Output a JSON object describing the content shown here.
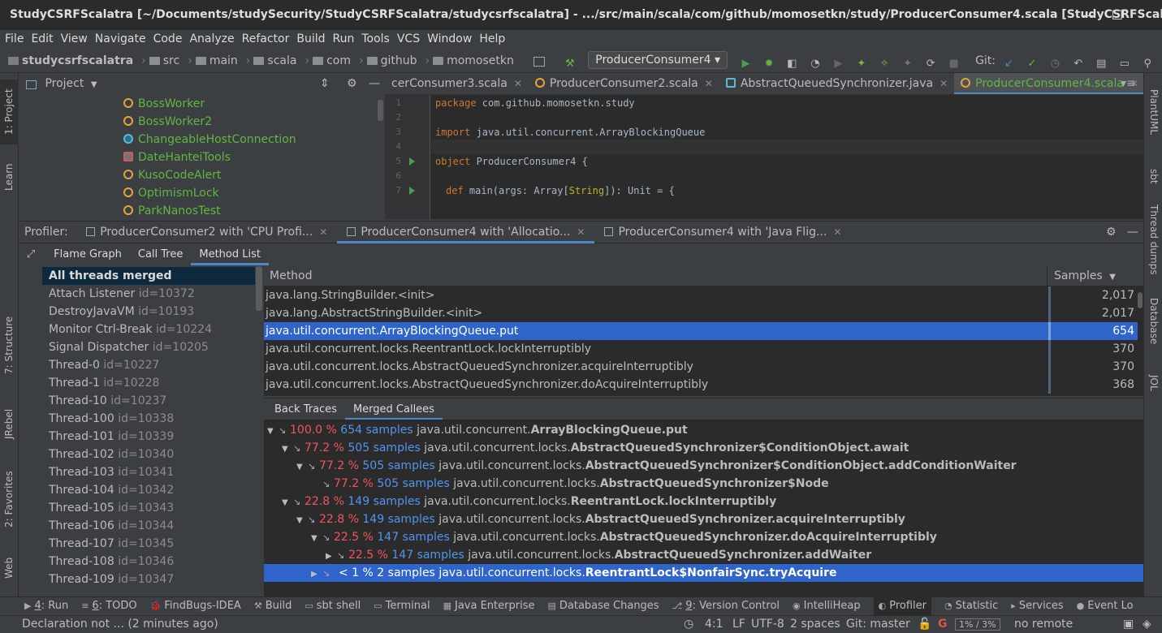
{
  "title_bar": {
    "title": "StudyCSRFScalatra [~/Documents/studySecurity/StudyCSRFScalatra/studycsrfscalatra] - .../src/main/scala/com/github/momosetkn/study/ProducerConsumer4.scala [StudyCSRFScalatra]"
  },
  "menu": [
    "File",
    "Edit",
    "View",
    "Navigate",
    "Code",
    "Analyze",
    "Refactor",
    "Build",
    "Run",
    "Tools",
    "VCS",
    "Window",
    "Help"
  ],
  "breadcrumbs": [
    "studycsrfscalatra",
    "src",
    "main",
    "scala",
    "com",
    "github",
    "momosetkn"
  ],
  "run_config": "ProducerConsumer4",
  "git_label": "Git:",
  "left_strip": [
    "1: Project",
    "Learn",
    "7: Structure",
    "JRebel",
    "2: Favorites",
    "Web"
  ],
  "right_strip": [
    "PlantUML",
    "sbt",
    "Thread dumps",
    "Database",
    "JOL"
  ],
  "project_panel": {
    "title": "Project",
    "items": [
      "BossWorker",
      "BossWorker2",
      "ChangeableHostConnection",
      "DateHanteiTools",
      "KusoCodeAlert",
      "OptimismLock",
      "ParkNanosTest"
    ]
  },
  "editor_tabs": [
    {
      "label": "cerConsumer3.scala",
      "active": false
    },
    {
      "label": "ProducerConsumer2.scala",
      "active": false
    },
    {
      "label": "AbstractQueuedSynchronizer.java",
      "active": false
    },
    {
      "label": "ProducerConsumer4.scala",
      "active": true
    }
  ],
  "editor": {
    "lines": [
      "1",
      "2",
      "3",
      "4",
      "5",
      "6",
      "7"
    ],
    "line1": {
      "kw": "package",
      "rest": " com.github.momosetkn.study"
    },
    "line3": {
      "kw": "import",
      "rest": " java.util.concurrent.ArrayBlockingQueue"
    },
    "line5": {
      "kw": "object",
      "rest": " ProducerConsumer4 {"
    },
    "line7": {
      "kw": "def",
      "name": " main(args: Array[",
      "type": "String",
      "rest": "]): Unit = {"
    }
  },
  "profiler": {
    "label": "Profiler:",
    "tabs": [
      {
        "label": "ProducerConsumer2 with 'CPU Profi...",
        "active": false
      },
      {
        "label": "ProducerConsumer4 with 'Allocatio...",
        "active": true
      },
      {
        "label": "ProducerConsumer4 with 'Java Flig...",
        "active": false
      }
    ],
    "subtabs": [
      "Flame Graph",
      "Call Tree",
      "Method List"
    ],
    "active_subtab": "Method List"
  },
  "threads": [
    {
      "name": "All threads merged",
      "id": ""
    },
    {
      "name": "Attach Listener",
      "id": "id=10372"
    },
    {
      "name": "DestroyJavaVM",
      "id": "id=10193"
    },
    {
      "name": "Monitor Ctrl-Break",
      "id": "id=10224"
    },
    {
      "name": "Signal Dispatcher",
      "id": "id=10205"
    },
    {
      "name": "Thread-0",
      "id": "id=10227"
    },
    {
      "name": "Thread-1",
      "id": "id=10228"
    },
    {
      "name": "Thread-10",
      "id": "id=10237"
    },
    {
      "name": "Thread-100",
      "id": "id=10338"
    },
    {
      "name": "Thread-101",
      "id": "id=10339"
    },
    {
      "name": "Thread-102",
      "id": "id=10340"
    },
    {
      "name": "Thread-103",
      "id": "id=10341"
    },
    {
      "name": "Thread-104",
      "id": "id=10342"
    },
    {
      "name": "Thread-105",
      "id": "id=10343"
    },
    {
      "name": "Thread-106",
      "id": "id=10344"
    },
    {
      "name": "Thread-107",
      "id": "id=10345"
    },
    {
      "name": "Thread-108",
      "id": "id=10346"
    },
    {
      "name": "Thread-109",
      "id": "id=10347"
    }
  ],
  "method_table": {
    "headers": [
      "Method",
      "Samples"
    ],
    "rows": [
      {
        "method": "java.lang.StringBuilder.<init>",
        "samples": "2,017"
      },
      {
        "method": "java.lang.AbstractStringBuilder.<init>",
        "samples": "2,017"
      },
      {
        "method": "java.util.concurrent.ArrayBlockingQueue.put",
        "samples": "654"
      },
      {
        "method": "java.util.concurrent.locks.ReentrantLock.lockInterruptibly",
        "samples": "370"
      },
      {
        "method": "java.util.concurrent.locks.AbstractQueuedSynchronizer.acquireInterruptibly",
        "samples": "370"
      },
      {
        "method": "java.util.concurrent.locks.AbstractQueuedSynchronizer.doAcquireInterruptibly",
        "samples": "368"
      }
    ]
  },
  "callee_tabs": [
    "Back Traces",
    "Merged Callees"
  ],
  "callees": [
    {
      "pct": "100.0 %",
      "samples": "654 samples",
      "pkg": "java.util.concurrent.",
      "cls": "ArrayBlockingQueue.put"
    },
    {
      "pct": "77.2 %",
      "samples": "505 samples",
      "pkg": "java.util.concurrent.locks.",
      "cls": "AbstractQueuedSynchronizer$ConditionObject.await"
    },
    {
      "pct": "77.2 %",
      "samples": "505 samples",
      "pkg": "java.util.concurrent.locks.",
      "cls": "AbstractQueuedSynchronizer$ConditionObject.addConditionWaiter"
    },
    {
      "pct": "77.2 %",
      "samples": "505 samples",
      "pkg": "java.util.concurrent.locks.",
      "cls": "AbstractQueuedSynchronizer$Node"
    },
    {
      "pct": "22.8 %",
      "samples": "149 samples",
      "pkg": "java.util.concurrent.locks.",
      "cls": "ReentrantLock.lockInterruptibly"
    },
    {
      "pct": "22.8 %",
      "samples": "149 samples",
      "pkg": "java.util.concurrent.locks.",
      "cls": "AbstractQueuedSynchronizer.acquireInterruptibly"
    },
    {
      "pct": "22.5 %",
      "samples": "147 samples",
      "pkg": "java.util.concurrent.locks.",
      "cls": "AbstractQueuedSynchronizer.doAcquireInterruptibly"
    },
    {
      "pct": "22.5 %",
      "samples": "147 samples",
      "pkg": "java.util.concurrent.locks.",
      "cls": "AbstractQueuedSynchronizer.addWaiter"
    },
    {
      "pct": "< 1 %",
      "samples": "2 samples",
      "pkg": "java.util.concurrent.locks.",
      "cls": "ReentrantLock$NonfairSync.tryAcquire"
    }
  ],
  "bottom_tabs": [
    {
      "num": "4",
      "label": ": Run"
    },
    {
      "num": "6",
      "label": ": TODO"
    },
    {
      "num": "",
      "label": "FindBugs-IDEA"
    },
    {
      "num": "",
      "label": "Build"
    },
    {
      "num": "",
      "label": "sbt shell"
    },
    {
      "num": "",
      "label": "Terminal"
    },
    {
      "num": "",
      "label": "Java Enterprise"
    },
    {
      "num": "",
      "label": "Database Changes"
    },
    {
      "num": "9",
      "label": ": Version Control"
    },
    {
      "num": "",
      "label": "IntelliHeap"
    },
    {
      "num": "",
      "label": "Profiler"
    },
    {
      "num": "",
      "label": "Statistic"
    },
    {
      "num": "",
      "label": "Services"
    },
    {
      "num": "",
      "label": "Event Lo"
    }
  ],
  "status": {
    "message": "Declaration not ... (2 minutes ago)",
    "position": "4:1",
    "line_sep": "LF",
    "encoding": "UTF-8",
    "indent": "2 spaces",
    "git": "Git: master",
    "memory": "1% / 3%",
    "remote": "no remote"
  },
  "colors": {
    "accent": "#4a88c7",
    "selection": "#2f65ca",
    "green": "#62b543",
    "percent": "#f0555f",
    "samples": "#5394ec"
  }
}
